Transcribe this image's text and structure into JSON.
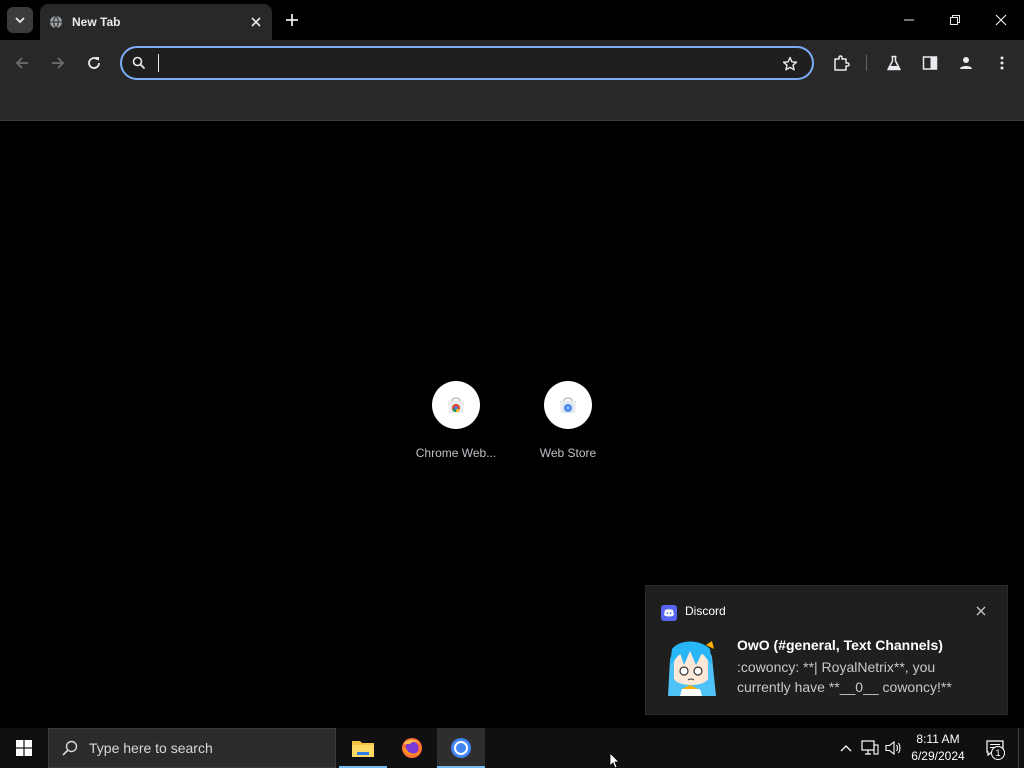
{
  "browser": {
    "tab": {
      "title": "New Tab"
    },
    "omnibox": {
      "value": "",
      "placeholder": ""
    }
  },
  "shortcuts": [
    {
      "label": "Chrome Web..."
    },
    {
      "label": "Web Store"
    }
  ],
  "notification": {
    "app_name": "Discord",
    "title": "OwO (#general, Text Channels)",
    "body": ":cowoncy: **| RoyalNetrix**, you currently have **__0__ cowoncy!**"
  },
  "taskbar": {
    "search_placeholder": "Type here to search",
    "apps": [
      "file-explorer",
      "firefox",
      "chrome"
    ],
    "clock": {
      "time": "8:11 AM",
      "date": "6/29/2024"
    },
    "notification_count": "1"
  },
  "colors": {
    "accent": "#7cacf8",
    "toolbar": "#282828",
    "taskbar": "#101010",
    "discord": "#5865f2"
  }
}
